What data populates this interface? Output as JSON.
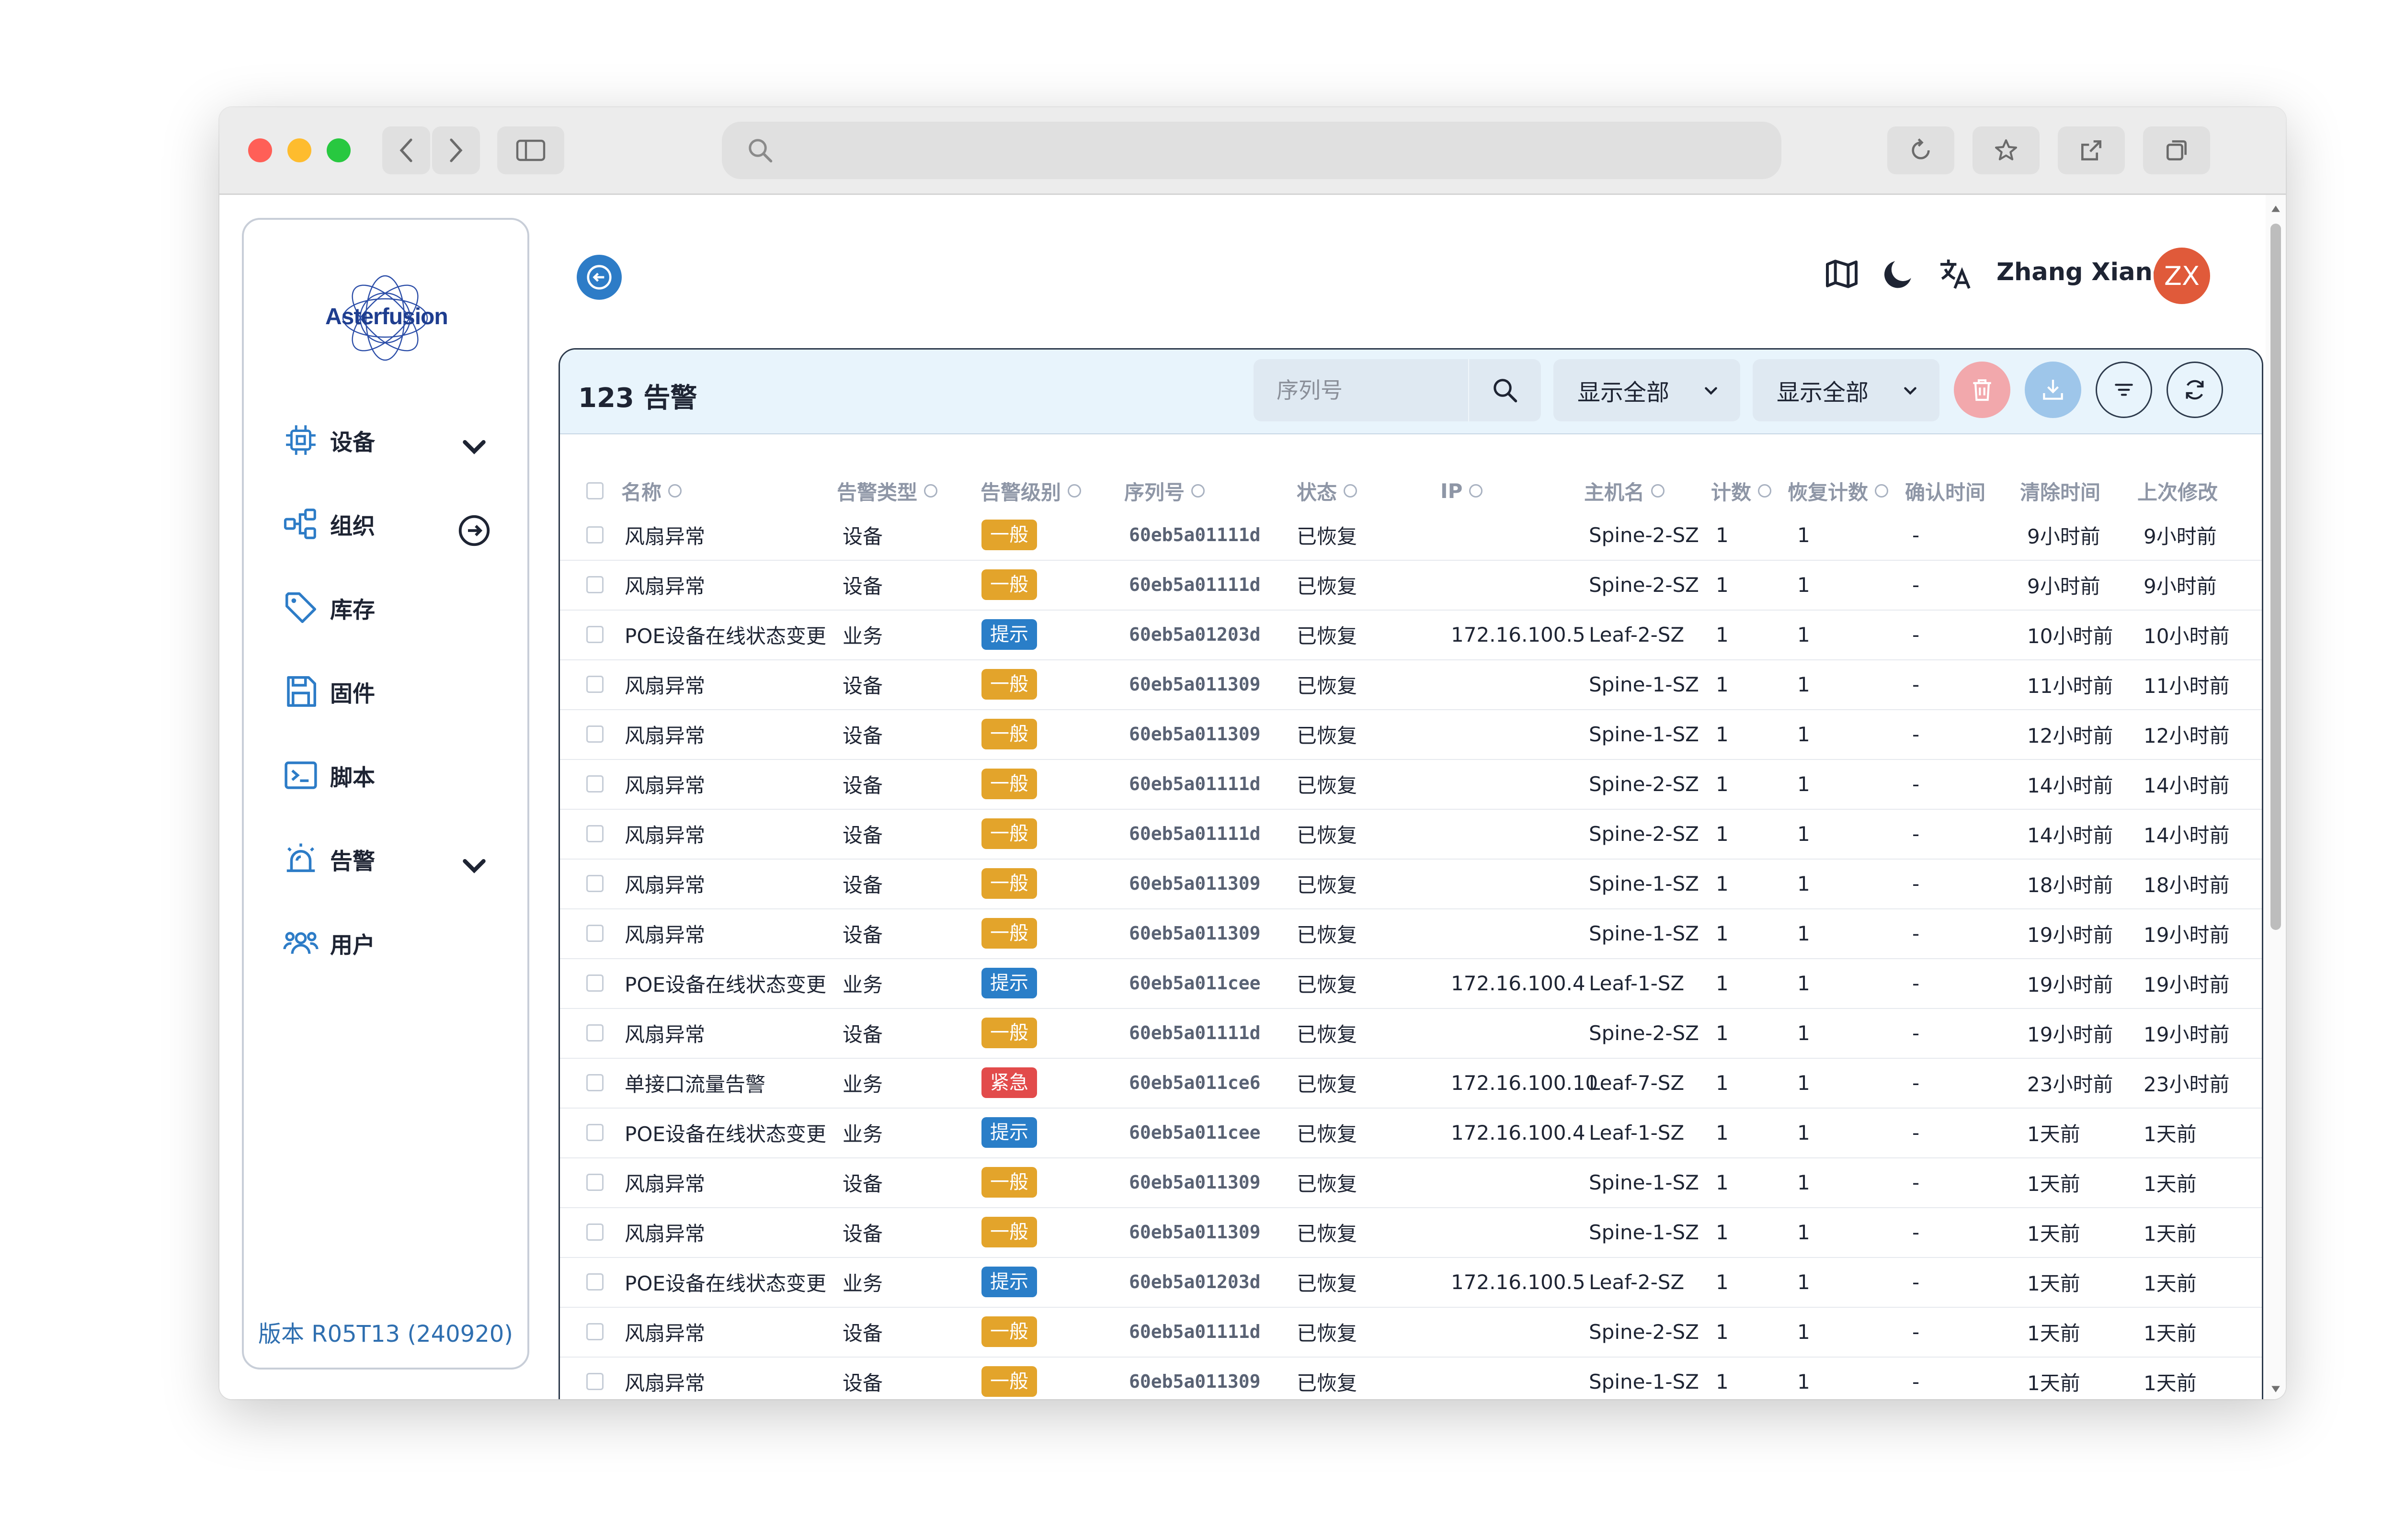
{
  "colors": {
    "level_general": "#e3a42b",
    "level_hint": "#2a7ec8",
    "level_urgent": "#e24b4b",
    "accent": "#2d7cc7",
    "avatar": "#e05a3a"
  },
  "sidebar": {
    "logo_text": "Asterfusion",
    "items": [
      {
        "label": "设备",
        "icon": "chip-icon",
        "has_chevron": true
      },
      {
        "label": "组织",
        "icon": "org-tree-icon",
        "has_arrow": true
      },
      {
        "label": "库存",
        "icon": "tag-icon"
      },
      {
        "label": "固件",
        "icon": "save-icon"
      },
      {
        "label": "脚本",
        "icon": "terminal-icon"
      },
      {
        "label": "告警",
        "icon": "alarm-icon",
        "has_chevron": true
      },
      {
        "label": "用户",
        "icon": "users-icon"
      }
    ],
    "version": "版本 R05T13 (240920)"
  },
  "header": {
    "user_name": "Zhang Xiang",
    "avatar_initials": "ZX"
  },
  "panel": {
    "title": "123 告警",
    "search_placeholder": "序列号",
    "filter1": "显示全部",
    "filter2": "显示全部"
  },
  "table": {
    "columns": [
      "名称",
      "告警类型",
      "告警级别",
      "序列号",
      "状态",
      "IP",
      "主机名",
      "计数",
      "恢复计数",
      "确认时间",
      "清除时间",
      "上次修改"
    ],
    "rows": [
      {
        "name": "风扇异常",
        "type": "设备",
        "level": "一般",
        "level_kind": "general",
        "serial": "60eb5a01111d",
        "status": "已恢复",
        "ip": "",
        "host": "Spine-2-SZ",
        "count": "1",
        "recover": "1",
        "confirm": "-",
        "clear": "9小时前",
        "modified": "9小时前"
      },
      {
        "name": "风扇异常",
        "type": "设备",
        "level": "一般",
        "level_kind": "general",
        "serial": "60eb5a01111d",
        "status": "已恢复",
        "ip": "",
        "host": "Spine-2-SZ",
        "count": "1",
        "recover": "1",
        "confirm": "-",
        "clear": "9小时前",
        "modified": "9小时前"
      },
      {
        "name": "POE设备在线状态变更",
        "type": "业务",
        "level": "提示",
        "level_kind": "hint",
        "serial": "60eb5a01203d",
        "status": "已恢复",
        "ip": "172.16.100.5",
        "host": "Leaf-2-SZ",
        "count": "1",
        "recover": "1",
        "confirm": "-",
        "clear": "10小时前",
        "modified": "10小时前"
      },
      {
        "name": "风扇异常",
        "type": "设备",
        "level": "一般",
        "level_kind": "general",
        "serial": "60eb5a011309",
        "status": "已恢复",
        "ip": "",
        "host": "Spine-1-SZ",
        "count": "1",
        "recover": "1",
        "confirm": "-",
        "clear": "11小时前",
        "modified": "11小时前"
      },
      {
        "name": "风扇异常",
        "type": "设备",
        "level": "一般",
        "level_kind": "general",
        "serial": "60eb5a011309",
        "status": "已恢复",
        "ip": "",
        "host": "Spine-1-SZ",
        "count": "1",
        "recover": "1",
        "confirm": "-",
        "clear": "12小时前",
        "modified": "12小时前"
      },
      {
        "name": "风扇异常",
        "type": "设备",
        "level": "一般",
        "level_kind": "general",
        "serial": "60eb5a01111d",
        "status": "已恢复",
        "ip": "",
        "host": "Spine-2-SZ",
        "count": "1",
        "recover": "1",
        "confirm": "-",
        "clear": "14小时前",
        "modified": "14小时前"
      },
      {
        "name": "风扇异常",
        "type": "设备",
        "level": "一般",
        "level_kind": "general",
        "serial": "60eb5a01111d",
        "status": "已恢复",
        "ip": "",
        "host": "Spine-2-SZ",
        "count": "1",
        "recover": "1",
        "confirm": "-",
        "clear": "14小时前",
        "modified": "14小时前"
      },
      {
        "name": "风扇异常",
        "type": "设备",
        "level": "一般",
        "level_kind": "general",
        "serial": "60eb5a011309",
        "status": "已恢复",
        "ip": "",
        "host": "Spine-1-SZ",
        "count": "1",
        "recover": "1",
        "confirm": "-",
        "clear": "18小时前",
        "modified": "18小时前"
      },
      {
        "name": "风扇异常",
        "type": "设备",
        "level": "一般",
        "level_kind": "general",
        "serial": "60eb5a011309",
        "status": "已恢复",
        "ip": "",
        "host": "Spine-1-SZ",
        "count": "1",
        "recover": "1",
        "confirm": "-",
        "clear": "19小时前",
        "modified": "19小时前"
      },
      {
        "name": "POE设备在线状态变更",
        "type": "业务",
        "level": "提示",
        "level_kind": "hint",
        "serial": "60eb5a011cee",
        "status": "已恢复",
        "ip": "172.16.100.4",
        "host": "Leaf-1-SZ",
        "count": "1",
        "recover": "1",
        "confirm": "-",
        "clear": "19小时前",
        "modified": "19小时前"
      },
      {
        "name": "风扇异常",
        "type": "设备",
        "level": "一般",
        "level_kind": "general",
        "serial": "60eb5a01111d",
        "status": "已恢复",
        "ip": "",
        "host": "Spine-2-SZ",
        "count": "1",
        "recover": "1",
        "confirm": "-",
        "clear": "19小时前",
        "modified": "19小时前"
      },
      {
        "name": "单接口流量告警",
        "type": "业务",
        "level": "紧急",
        "level_kind": "urgent",
        "serial": "60eb5a011ce6",
        "status": "已恢复",
        "ip": "172.16.100.10",
        "host": "Leaf-7-SZ",
        "count": "1",
        "recover": "1",
        "confirm": "-",
        "clear": "23小时前",
        "modified": "23小时前"
      },
      {
        "name": "POE设备在线状态变更",
        "type": "业务",
        "level": "提示",
        "level_kind": "hint",
        "serial": "60eb5a011cee",
        "status": "已恢复",
        "ip": "172.16.100.4",
        "host": "Leaf-1-SZ",
        "count": "1",
        "recover": "1",
        "confirm": "-",
        "clear": "1天前",
        "modified": "1天前"
      },
      {
        "name": "风扇异常",
        "type": "设备",
        "level": "一般",
        "level_kind": "general",
        "serial": "60eb5a011309",
        "status": "已恢复",
        "ip": "",
        "host": "Spine-1-SZ",
        "count": "1",
        "recover": "1",
        "confirm": "-",
        "clear": "1天前",
        "modified": "1天前"
      },
      {
        "name": "风扇异常",
        "type": "设备",
        "level": "一般",
        "level_kind": "general",
        "serial": "60eb5a011309",
        "status": "已恢复",
        "ip": "",
        "host": "Spine-1-SZ",
        "count": "1",
        "recover": "1",
        "confirm": "-",
        "clear": "1天前",
        "modified": "1天前"
      },
      {
        "name": "POE设备在线状态变更",
        "type": "业务",
        "level": "提示",
        "level_kind": "hint",
        "serial": "60eb5a01203d",
        "status": "已恢复",
        "ip": "172.16.100.5",
        "host": "Leaf-2-SZ",
        "count": "1",
        "recover": "1",
        "confirm": "-",
        "clear": "1天前",
        "modified": "1天前"
      },
      {
        "name": "风扇异常",
        "type": "设备",
        "level": "一般",
        "level_kind": "general",
        "serial": "60eb5a01111d",
        "status": "已恢复",
        "ip": "",
        "host": "Spine-2-SZ",
        "count": "1",
        "recover": "1",
        "confirm": "-",
        "clear": "1天前",
        "modified": "1天前"
      },
      {
        "name": "风扇异常",
        "type": "设备",
        "level": "一般",
        "level_kind": "general",
        "serial": "60eb5a011309",
        "status": "已恢复",
        "ip": "",
        "host": "Spine-1-SZ",
        "count": "1",
        "recover": "1",
        "confirm": "-",
        "clear": "1天前",
        "modified": "1天前"
      }
    ]
  }
}
